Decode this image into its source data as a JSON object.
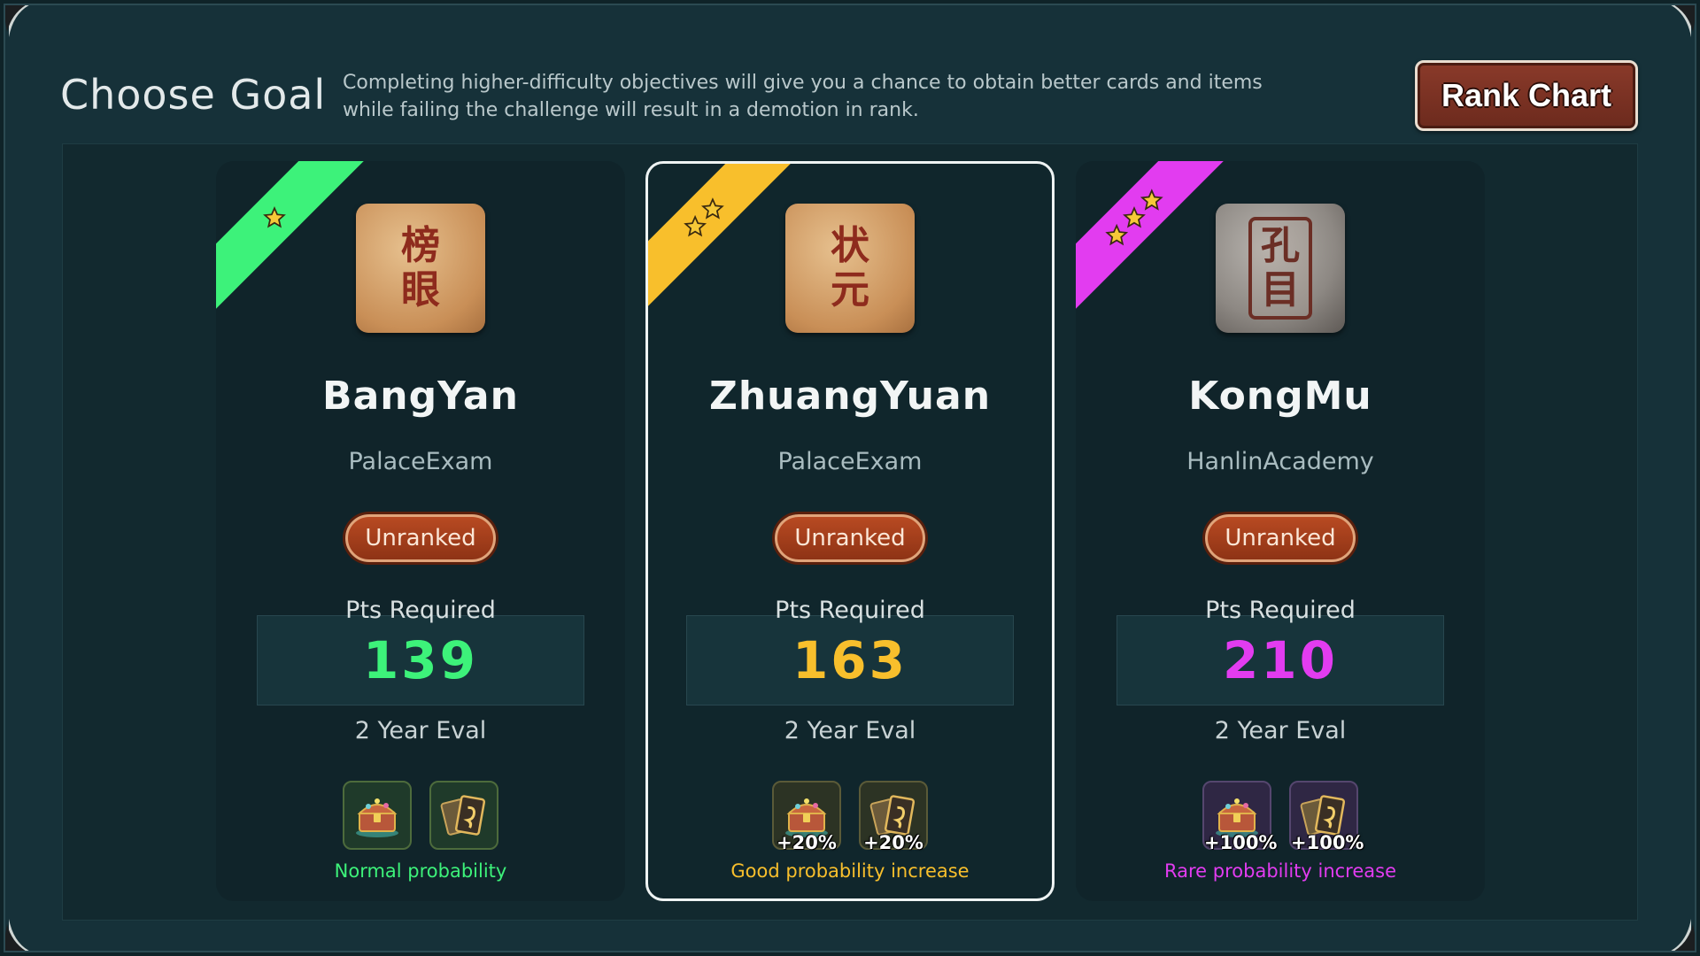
{
  "header": {
    "title": "Choose Goal",
    "description": "Completing higher-difficulty objectives will give you a chance to obtain better cards and items\nwhile failing the challenge will result in a demotion in rank.",
    "rank_chart_label": "Rank Chart"
  },
  "colors": {
    "tier1": "#3df27a",
    "tier2": "#f8bf2c",
    "tier3": "#e23cf0",
    "badge": "#a94020"
  },
  "cards": [
    {
      "name": "BangYan",
      "glyph_top": "榜",
      "glyph_bottom": "眼",
      "category": "PalaceExam",
      "rank": "Unranked",
      "pts_label": "Pts Required",
      "pts": "139",
      "eval": "2 Year Eval",
      "stars": 1,
      "reward_chest_bonus": "",
      "reward_cards_bonus": "",
      "probability": "Normal probability",
      "selected": false
    },
    {
      "name": "ZhuangYuan",
      "glyph_top": "状",
      "glyph_bottom": "元",
      "category": "PalaceExam",
      "rank": "Unranked",
      "pts_label": "Pts Required",
      "pts": "163",
      "eval": "2 Year Eval",
      "stars": 2,
      "reward_chest_bonus": "+20%",
      "reward_cards_bonus": "+20%",
      "probability": "Good probability increase",
      "selected": true
    },
    {
      "name": "KongMu",
      "glyph_top": "孔",
      "glyph_bottom": "目",
      "category": "HanlinAcademy",
      "rank": "Unranked",
      "pts_label": "Pts Required",
      "pts": "210",
      "eval": "2 Year Eval",
      "stars": 3,
      "reward_chest_bonus": "+100%",
      "reward_cards_bonus": "+100%",
      "probability": "Rare probability increase",
      "selected": false
    }
  ],
  "icons": {
    "ribbon_star": "star-icon",
    "reward_chest": "treasure-chest-icon",
    "reward_cards": "cards-icon"
  }
}
